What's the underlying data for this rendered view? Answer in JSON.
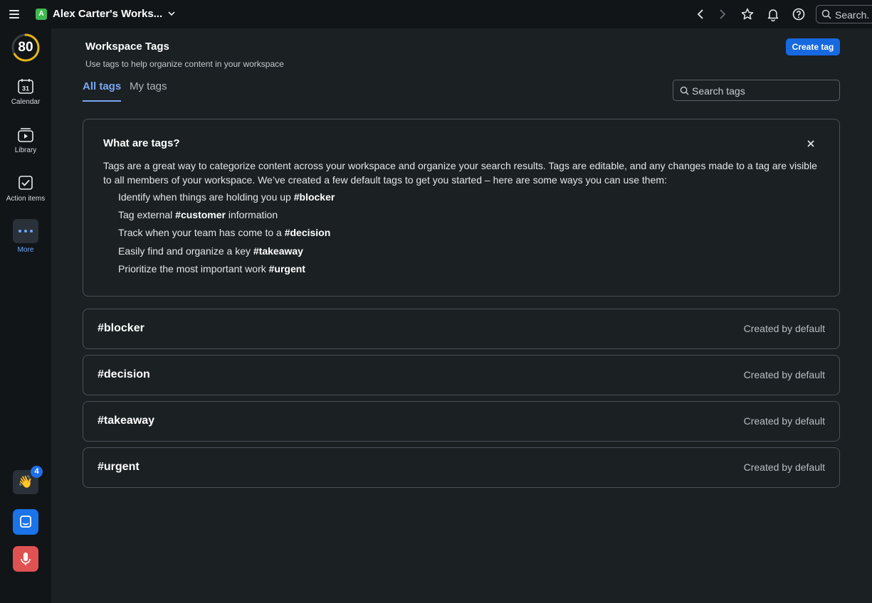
{
  "header": {
    "workspace_badge": "A",
    "workspace_name": "Alex Carter's Works...",
    "search_label": "Search.",
    "accent_color": "#3fb950"
  },
  "sidebar": {
    "score": "80",
    "calendar_day": "31",
    "items": [
      {
        "label": "Calendar",
        "icon": "calendar-icon"
      },
      {
        "label": "Library",
        "icon": "library-icon"
      },
      {
        "label": "Action items",
        "icon": "checkbox-icon"
      },
      {
        "label": "More",
        "icon": "more-icon"
      }
    ],
    "wave_emoji": "👋",
    "notification_count": "4"
  },
  "main": {
    "title": "Workspace Tags",
    "subtitle": "Use tags to help organize content in your workspace",
    "create_button": "Create tag",
    "tabs": [
      {
        "label": "All tags",
        "active": true
      },
      {
        "label": "My tags",
        "active": false
      }
    ],
    "search_placeholder": "Search tags",
    "info": {
      "title": "What are tags?",
      "body": "Tags are a great way to categorize content across your workspace and organize your search results. Tags are editable, and any changes made to a tag are visible to all members of your workspace. We’ve created a few default tags to get you started – here are some ways you can use them:",
      "items": [
        {
          "text": "Identify when things are holding you up ",
          "tag": "#blocker",
          "after": ""
        },
        {
          "text": "Tag external ",
          "tag": "#customer",
          "after": " information"
        },
        {
          "text": "Track when your team has come to a ",
          "tag": "#decision",
          "after": ""
        },
        {
          "text": "Easily find and organize a key ",
          "tag": "#takeaway",
          "after": ""
        },
        {
          "text": "Prioritize the most important work ",
          "tag": "#urgent",
          "after": ""
        }
      ]
    },
    "tags": [
      {
        "name": "#blocker",
        "meta": "Created by default"
      },
      {
        "name": "#decision",
        "meta": "Created by default"
      },
      {
        "name": "#takeaway",
        "meta": "Created by default"
      },
      {
        "name": "#urgent",
        "meta": "Created by default"
      }
    ]
  }
}
